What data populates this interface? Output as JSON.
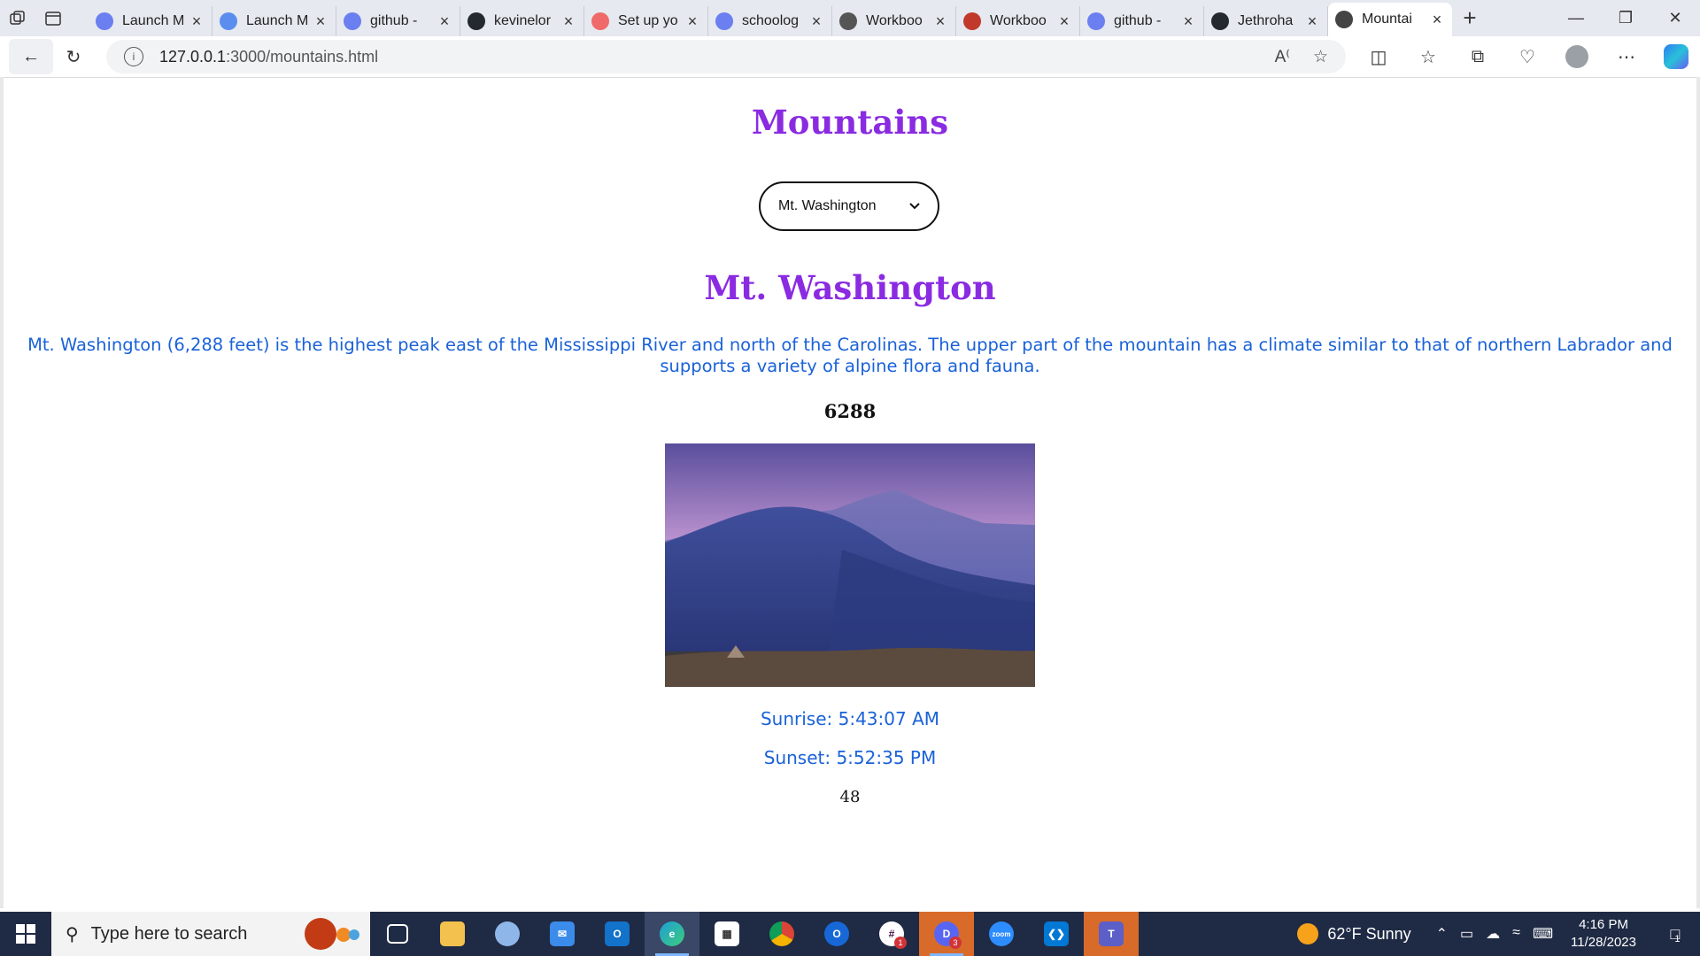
{
  "browser": {
    "tabs": [
      {
        "label": "Launch M",
        "icon": "zoom-icon",
        "color": "#6b7ff0"
      },
      {
        "label": "Launch M",
        "icon": "zoom-icon",
        "color": "#5b8def"
      },
      {
        "label": "github -",
        "icon": "search-icon",
        "color": "#6b7ff0"
      },
      {
        "label": "kevinelor",
        "icon": "github-icon",
        "color": "#24292f"
      },
      {
        "label": "Set up yo",
        "icon": "asana-icon",
        "color": "#f06a6a"
      },
      {
        "label": "schoolog",
        "icon": "search-icon",
        "color": "#6b7ff0"
      },
      {
        "label": "Workboo",
        "icon": "s-circle-icon",
        "color": "#555555"
      },
      {
        "label": "Workboo",
        "icon": "pdf-icon",
        "color": "#c0392b"
      },
      {
        "label": "github -",
        "icon": "search-icon",
        "color": "#6b7ff0"
      },
      {
        "label": "Jethroha",
        "icon": "github-icon",
        "color": "#24292f"
      },
      {
        "label": "Mountai",
        "icon": "page-icon",
        "color": "#444444",
        "active": true
      }
    ],
    "url_host": "127.0.0.1",
    "url_path": ":3000/mountains.html"
  },
  "page": {
    "title": "Mountains",
    "select": {
      "selected": "Mt. Washington"
    },
    "mountain": {
      "name": "Mt. Washington",
      "description": "Mt. Washington (6,288 feet) is the highest peak east of the Mississippi River and north of the Carolinas. The upper part of the mountain has a climate similar to that of northern Labrador and supports a variety of alpine flora and fauna.",
      "elevation": "6288",
      "sunrise": "Sunrise: 5:43:07 AM",
      "sunset": "Sunset: 5:52:35 PM",
      "count": "48"
    },
    "colors": {
      "title": "#8a2be2",
      "text_blue": "#1a62d8"
    }
  },
  "taskbar": {
    "search_placeholder": "Type here to search",
    "weather": "62°F  Sunny",
    "time": "4:16 PM",
    "date": "11/28/2023",
    "notifications": "1"
  }
}
